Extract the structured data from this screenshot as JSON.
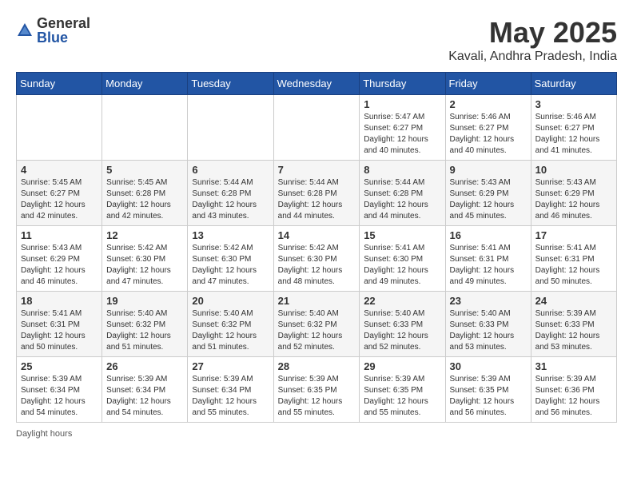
{
  "logo": {
    "general": "General",
    "blue": "Blue"
  },
  "title": "May 2025",
  "location": "Kavali, Andhra Pradesh, India",
  "weekdays": [
    "Sunday",
    "Monday",
    "Tuesday",
    "Wednesday",
    "Thursday",
    "Friday",
    "Saturday"
  ],
  "weeks": [
    [
      {
        "day": "",
        "info": ""
      },
      {
        "day": "",
        "info": ""
      },
      {
        "day": "",
        "info": ""
      },
      {
        "day": "",
        "info": ""
      },
      {
        "day": "1",
        "info": "Sunrise: 5:47 AM\nSunset: 6:27 PM\nDaylight: 12 hours\nand 40 minutes."
      },
      {
        "day": "2",
        "info": "Sunrise: 5:46 AM\nSunset: 6:27 PM\nDaylight: 12 hours\nand 40 minutes."
      },
      {
        "day": "3",
        "info": "Sunrise: 5:46 AM\nSunset: 6:27 PM\nDaylight: 12 hours\nand 41 minutes."
      }
    ],
    [
      {
        "day": "4",
        "info": "Sunrise: 5:45 AM\nSunset: 6:27 PM\nDaylight: 12 hours\nand 42 minutes."
      },
      {
        "day": "5",
        "info": "Sunrise: 5:45 AM\nSunset: 6:28 PM\nDaylight: 12 hours\nand 42 minutes."
      },
      {
        "day": "6",
        "info": "Sunrise: 5:44 AM\nSunset: 6:28 PM\nDaylight: 12 hours\nand 43 minutes."
      },
      {
        "day": "7",
        "info": "Sunrise: 5:44 AM\nSunset: 6:28 PM\nDaylight: 12 hours\nand 44 minutes."
      },
      {
        "day": "8",
        "info": "Sunrise: 5:44 AM\nSunset: 6:28 PM\nDaylight: 12 hours\nand 44 minutes."
      },
      {
        "day": "9",
        "info": "Sunrise: 5:43 AM\nSunset: 6:29 PM\nDaylight: 12 hours\nand 45 minutes."
      },
      {
        "day": "10",
        "info": "Sunrise: 5:43 AM\nSunset: 6:29 PM\nDaylight: 12 hours\nand 46 minutes."
      }
    ],
    [
      {
        "day": "11",
        "info": "Sunrise: 5:43 AM\nSunset: 6:29 PM\nDaylight: 12 hours\nand 46 minutes."
      },
      {
        "day": "12",
        "info": "Sunrise: 5:42 AM\nSunset: 6:30 PM\nDaylight: 12 hours\nand 47 minutes."
      },
      {
        "day": "13",
        "info": "Sunrise: 5:42 AM\nSunset: 6:30 PM\nDaylight: 12 hours\nand 47 minutes."
      },
      {
        "day": "14",
        "info": "Sunrise: 5:42 AM\nSunset: 6:30 PM\nDaylight: 12 hours\nand 48 minutes."
      },
      {
        "day": "15",
        "info": "Sunrise: 5:41 AM\nSunset: 6:30 PM\nDaylight: 12 hours\nand 49 minutes."
      },
      {
        "day": "16",
        "info": "Sunrise: 5:41 AM\nSunset: 6:31 PM\nDaylight: 12 hours\nand 49 minutes."
      },
      {
        "day": "17",
        "info": "Sunrise: 5:41 AM\nSunset: 6:31 PM\nDaylight: 12 hours\nand 50 minutes."
      }
    ],
    [
      {
        "day": "18",
        "info": "Sunrise: 5:41 AM\nSunset: 6:31 PM\nDaylight: 12 hours\nand 50 minutes."
      },
      {
        "day": "19",
        "info": "Sunrise: 5:40 AM\nSunset: 6:32 PM\nDaylight: 12 hours\nand 51 minutes."
      },
      {
        "day": "20",
        "info": "Sunrise: 5:40 AM\nSunset: 6:32 PM\nDaylight: 12 hours\nand 51 minutes."
      },
      {
        "day": "21",
        "info": "Sunrise: 5:40 AM\nSunset: 6:32 PM\nDaylight: 12 hours\nand 52 minutes."
      },
      {
        "day": "22",
        "info": "Sunrise: 5:40 AM\nSunset: 6:33 PM\nDaylight: 12 hours\nand 52 minutes."
      },
      {
        "day": "23",
        "info": "Sunrise: 5:40 AM\nSunset: 6:33 PM\nDaylight: 12 hours\nand 53 minutes."
      },
      {
        "day": "24",
        "info": "Sunrise: 5:39 AM\nSunset: 6:33 PM\nDaylight: 12 hours\nand 53 minutes."
      }
    ],
    [
      {
        "day": "25",
        "info": "Sunrise: 5:39 AM\nSunset: 6:34 PM\nDaylight: 12 hours\nand 54 minutes."
      },
      {
        "day": "26",
        "info": "Sunrise: 5:39 AM\nSunset: 6:34 PM\nDaylight: 12 hours\nand 54 minutes."
      },
      {
        "day": "27",
        "info": "Sunrise: 5:39 AM\nSunset: 6:34 PM\nDaylight: 12 hours\nand 55 minutes."
      },
      {
        "day": "28",
        "info": "Sunrise: 5:39 AM\nSunset: 6:35 PM\nDaylight: 12 hours\nand 55 minutes."
      },
      {
        "day": "29",
        "info": "Sunrise: 5:39 AM\nSunset: 6:35 PM\nDaylight: 12 hours\nand 55 minutes."
      },
      {
        "day": "30",
        "info": "Sunrise: 5:39 AM\nSunset: 6:35 PM\nDaylight: 12 hours\nand 56 minutes."
      },
      {
        "day": "31",
        "info": "Sunrise: 5:39 AM\nSunset: 6:36 PM\nDaylight: 12 hours\nand 56 minutes."
      }
    ]
  ],
  "footer": {
    "daylight_hours": "Daylight hours"
  }
}
